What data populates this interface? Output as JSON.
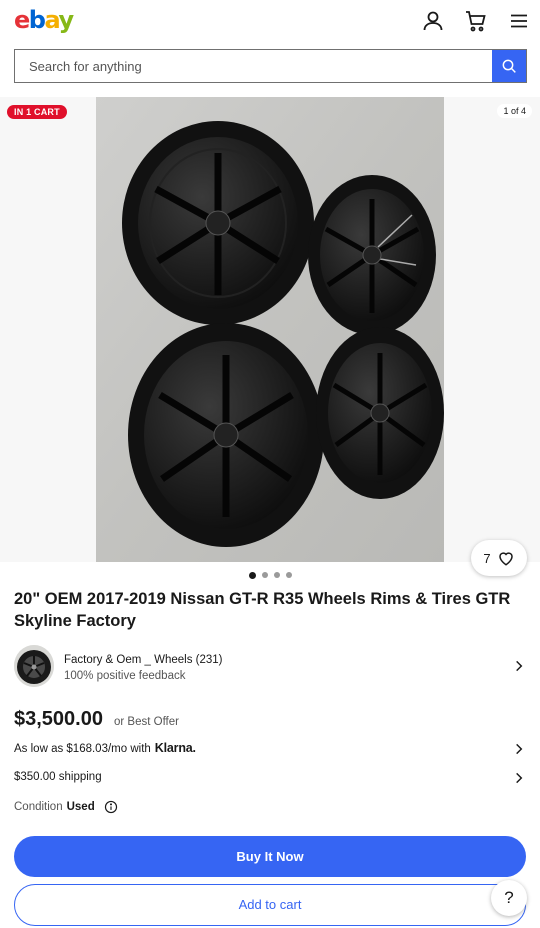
{
  "header": {
    "logo": {
      "l1": "e",
      "l2": "b",
      "l3": "a",
      "l4": "y"
    },
    "icons": [
      "user-icon",
      "cart-icon",
      "menu-icon"
    ]
  },
  "search": {
    "placeholder": "Search for anything",
    "value": ""
  },
  "gallery": {
    "badge": "IN 1 CART",
    "counter": "1 of 4",
    "watch_count": "7",
    "dots_total": 4,
    "active_dot": 1
  },
  "listing": {
    "title": "20\" OEM 2017-2019 Nissan GT-R R35 Wheels Rims & Tires GTR Skyline Factory",
    "seller_name": "Factory & Oem _ Wheels (231)",
    "seller_feedback": "100% positive feedback",
    "price": "$3,500.00",
    "best_offer": "or Best Offer",
    "financing_text": "As low as $168.03/mo with",
    "financing_brand": "Klarna.",
    "shipping": "$350.00 shipping",
    "condition_label": "Condition",
    "condition_value": "Used"
  },
  "actions": {
    "buy_now": "Buy It Now",
    "add_to_cart": "Add to cart",
    "help": "?"
  },
  "colors": {
    "accent": "#3665f3",
    "badge": "#e0102b"
  }
}
